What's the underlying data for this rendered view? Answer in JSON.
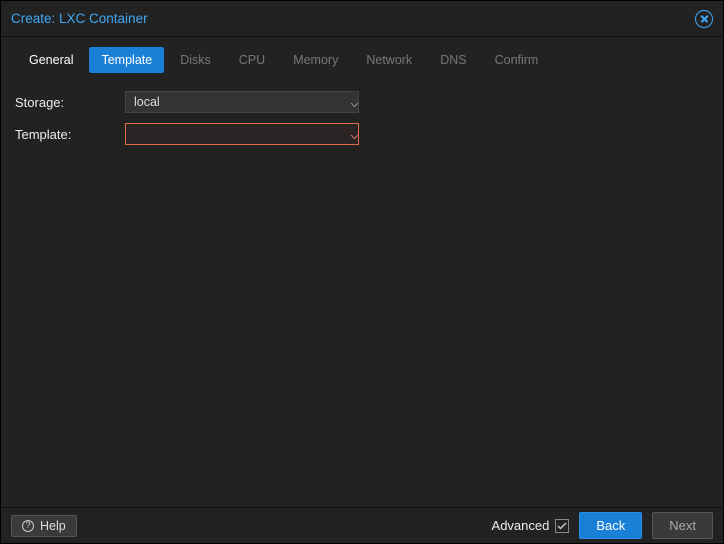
{
  "titlebar": {
    "title": "Create: LXC Container"
  },
  "tabs": {
    "general": "General",
    "template": "Template",
    "disks": "Disks",
    "cpu": "CPU",
    "memory": "Memory",
    "network": "Network",
    "dns": "DNS",
    "confirm": "Confirm"
  },
  "form": {
    "storage_label": "Storage:",
    "storage_value": "local",
    "template_label": "Template:",
    "template_value": ""
  },
  "footer": {
    "help": "Help",
    "advanced": "Advanced",
    "advanced_checked": true,
    "back": "Back",
    "next": "Next"
  },
  "colors": {
    "accent": "#3fa9f5",
    "primary_btn": "#1a7fd6",
    "error_border": "#e06c4a"
  }
}
